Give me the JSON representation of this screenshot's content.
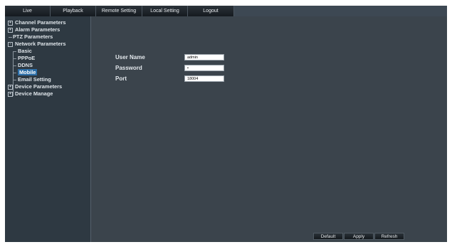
{
  "topnav": {
    "tabs": [
      "Live",
      "Playback",
      "Remote Setting",
      "Local Setting",
      "Logout"
    ]
  },
  "sidebar": {
    "items": [
      {
        "label": "Channel Parameters",
        "expander": "+"
      },
      {
        "label": "Alarm Parameters",
        "expander": "+"
      },
      {
        "label": "PTZ Parameters"
      },
      {
        "label": "Network Parameters",
        "expander": "-"
      },
      {
        "label": "Basic"
      },
      {
        "label": "PPPoE"
      },
      {
        "label": "DDNS"
      },
      {
        "label": "Mobile"
      },
      {
        "label": "Email Setting"
      },
      {
        "label": "Device Parameters",
        "expander": "+"
      },
      {
        "label": "Device Manage",
        "expander": "+"
      }
    ],
    "selected": "Mobile"
  },
  "form": {
    "username_label": "User Name",
    "username_value": "admin",
    "password_label": "Password",
    "password_value": "•",
    "port_label": "Port",
    "port_value": "18004"
  },
  "buttons": {
    "default_label": "Default",
    "apply_label": "Apply",
    "refresh_label": "Refresh"
  },
  "colors": {
    "background": "#3b444c",
    "sidebar": "#2e3942",
    "selected": "#2b6ea8"
  }
}
